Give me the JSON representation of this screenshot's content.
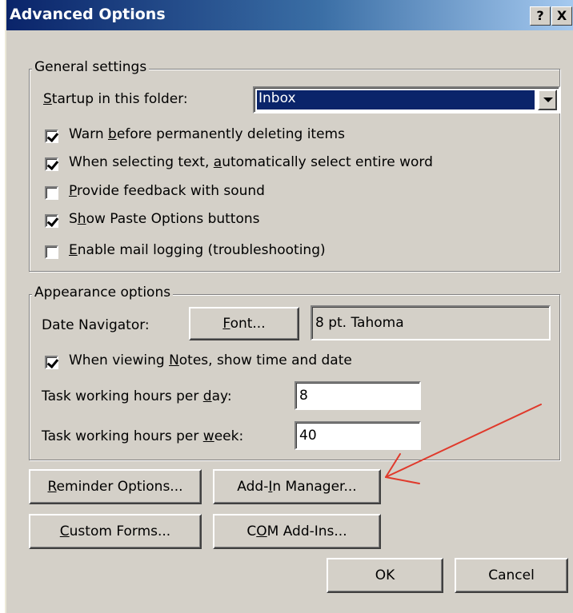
{
  "window": {
    "title": "Advanced Options",
    "help_glyph": "?",
    "close_glyph": "X"
  },
  "general": {
    "legend": "General settings",
    "startup_label_pre": "",
    "startup_label_u": "S",
    "startup_label_post": "tartup in this folder:",
    "startup_value": "Inbox",
    "options": [
      {
        "pre": "Warn ",
        "u": "b",
        "post": "efore permanently deleting items",
        "checked": true
      },
      {
        "pre": "When selecting text, ",
        "u": "a",
        "post": "utomatically select entire word",
        "checked": true
      },
      {
        "pre": "",
        "u": "P",
        "post": "rovide feedback with sound",
        "checked": false
      },
      {
        "pre": "S",
        "u": "h",
        "post": "ow Paste Options buttons",
        "checked": true
      },
      {
        "pre": "",
        "u": "E",
        "post": "nable mail logging (troubleshooting)",
        "checked": false
      }
    ]
  },
  "appearance": {
    "legend": "Appearance options",
    "date_nav_label": "Date Navigator:",
    "font_button_u": "F",
    "font_button_post": "ont...",
    "font_value": "8 pt. Tahoma",
    "notes_pre": "When viewing ",
    "notes_u": "N",
    "notes_post": "otes, show time and date",
    "notes_checked": true,
    "hours_day_pre": "Task working hours per ",
    "hours_day_u": "d",
    "hours_day_post": "ay:",
    "hours_day_value": "8",
    "hours_week_pre": "Task working hours per ",
    "hours_week_u": "w",
    "hours_week_post": "eek:",
    "hours_week_value": "40"
  },
  "buttons": {
    "reminder_u": "R",
    "reminder_post": "eminder Options...",
    "addin_pre": "Add-",
    "addin_u": "I",
    "addin_post": "n Manager...",
    "custom_u": "C",
    "custom_post": "ustom Forms...",
    "com_pre": "C",
    "com_u": "O",
    "com_post": "M Add-Ins...",
    "ok": "OK",
    "cancel": "Cancel"
  },
  "colors": {
    "dialog_bg": "#d4d0c8",
    "title_start": "#0a246a",
    "title_end": "#a6caf0",
    "annotation": "#e0392b"
  }
}
